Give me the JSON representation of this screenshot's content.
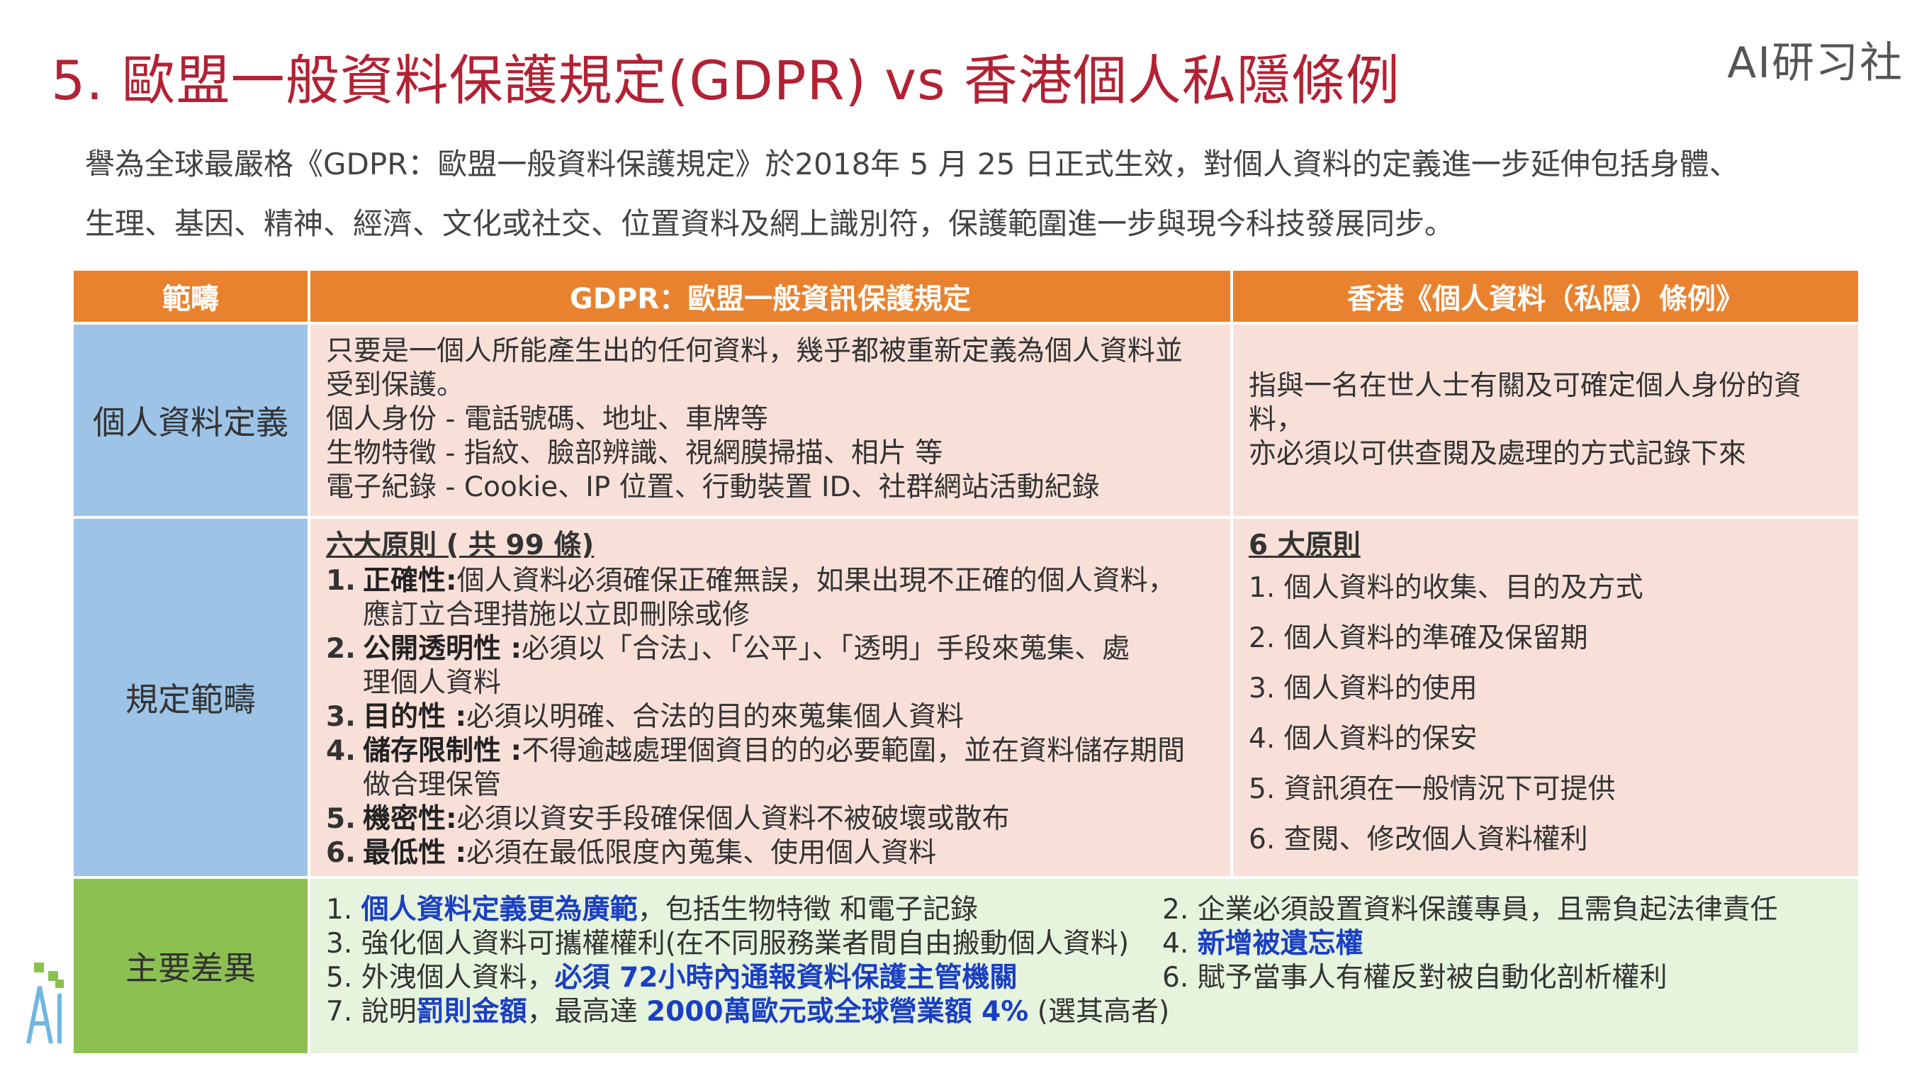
{
  "slide": {
    "title": "5. 歐盟一般資料保護規定(GDPR)  vs 香港個人私隱條例",
    "brand": "AI研习社",
    "intro_line1": "譽為全球最嚴格《GDPR：歐盟一般資料保護規定》於2018年 5 月 25 日正式生效，對個人資料的定義進一步延伸包括身體、",
    "intro_line2": "生理、基因、精神、經濟、文化或社交、位置資料及網上識別符，保護範圍進一步與現今科技發展同步。"
  },
  "table": {
    "headers": [
      "範疇",
      "GDPR：歐盟一般資訊保護規定",
      "香港《個人資料（私隱）條例》"
    ],
    "personal_data": {
      "category": "個人資料定義",
      "gdpr_lines": [
        "只要是一個人所能產生出的任何資料，幾乎都被重新定義為個人資料並",
        "受到保護。",
        "個人身份 - 電話號碼、地址、車牌等",
        "生物特徵 - 指紋、臉部辨識、視網膜掃描、相片 等",
        "電子紀錄 - Cookie、IP 位置、行動裝置 ID、社群網站活動紀錄"
      ],
      "hk_lines": [
        "指與一名在世人士有關及可確定個人身份的資料，",
        "亦必須以可供查閱及處理的方式記錄下來"
      ]
    },
    "scope": {
      "category": "規定範疇",
      "gdpr_heading": "六大原則 ( 共 99 條)",
      "gdpr_principles": [
        {
          "num": "1.",
          "term": "正確性:",
          "text": "個人資料必須確保正確無誤，如果出現不正確的個人資料，",
          "cont": "應訂立合理措施以立即刪除或修"
        },
        {
          "num": "2.",
          "term": "公開透明性 :",
          "text": "必須以「合法」、「公平」、「透明」手段來蒐集、處",
          "cont": "理個人資料"
        },
        {
          "num": "3.",
          "term": "目的性 :",
          "text": "必須以明確、合法的目的來蒐集個人資料",
          "cont": ""
        },
        {
          "num": "4.",
          "term": "儲存限制性 :",
          "text": "不得逾越處理個資目的的必要範圍，並在資料儲存期間",
          "cont": "做合理保管"
        },
        {
          "num": "5.",
          "term": "機密性:",
          "text": "必須以資安手段確保個人資料不被破壞或散布",
          "cont": ""
        },
        {
          "num": "6.",
          "term": "最低性 :",
          "text": "必須在最低限度內蒐集、使用個人資料",
          "cont": ""
        }
      ],
      "hk_heading": "6 大原則",
      "hk_principles": [
        "1. 個人資料的收集、目的及方式",
        "2. 個人資料的準確及保留期",
        "3. 個人資料的使用",
        "4. 個人資料的保安",
        "5. 資訊須在一般情況下可提供",
        "6. 查閱、修改個人資料權利"
      ]
    },
    "differences": {
      "category": "主要差異",
      "item1_prefix": "1. ",
      "item1_bold": "個人資料定義更為廣範",
      "item1_rest": "，包括生物特徵 和電子記錄",
      "item3": "3. 強化個人資料可攜權權利(在不同服務業者間自由搬動個人資料)",
      "item5_prefix": "5. 外洩個人資料，",
      "item5_bold": "必須 72小時內通報資料保護主管機關",
      "item7_prefix": "7. 說明",
      "item7_bold1": "罰則金額",
      "item7_mid": "，最高達 ",
      "item7_bold2": "2000萬歐元或全球營業額 4%",
      "item7_rest": " (選其高者)",
      "item2": "2.   企業必須設置資料保護專員，且需負起法律責任",
      "item4_prefix": "4.   ",
      "item4_bold": "新增被遺忘權",
      "item6": "6.   賦予當事人有權反對被自動化剖析權利"
    }
  },
  "colors": {
    "title": "#b22234",
    "header_orange": "#e9822e",
    "category_blue": "#9dc3e6",
    "category_green": "#8cc152",
    "cell_pink": "#f8e0d9",
    "cell_light_green": "#e6f4dd",
    "highlight_blue": "#1a3fc4"
  }
}
